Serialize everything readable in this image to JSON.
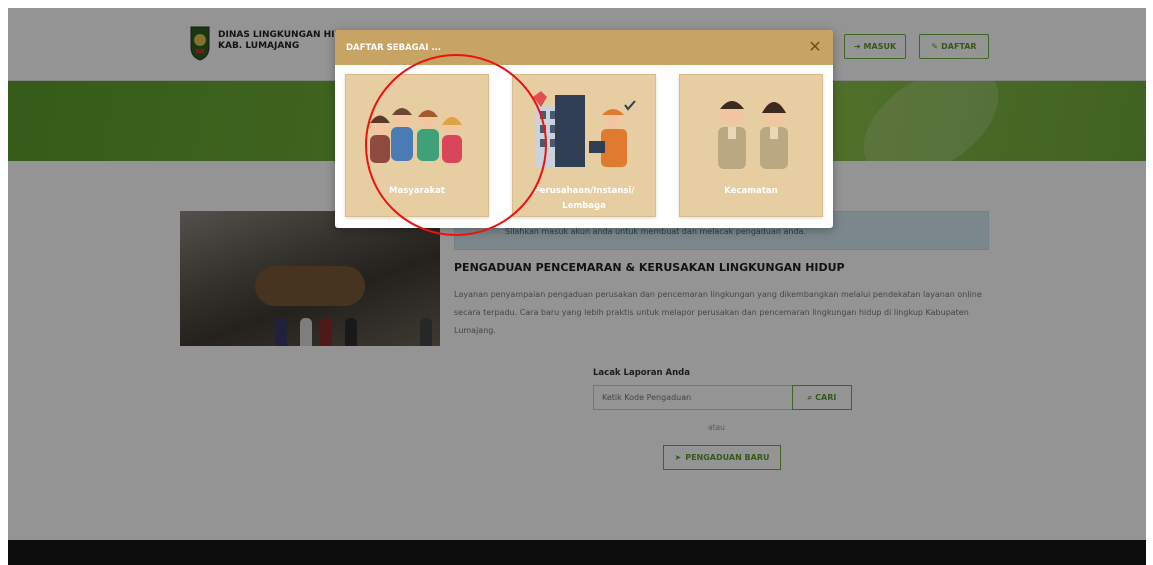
{
  "header": {
    "brand_line1": "DINAS LINGKUNGAN HIDUP",
    "brand_line2": "KAB. LUMAJANG",
    "masuk_label": "MASUK",
    "daftar_label": "DAFTAR"
  },
  "main": {
    "alert_text": "Silahkan masuk akun anda untuk membuat dan melacak pengaduan anda.",
    "section_title": "PENGADUAN PENCEMARAN & KERUSAKAN LINGKUNGAN HIDUP",
    "section_desc": "Layanan penyampaian pengaduan perusakan dan pencemaran lingkungan yang dikembangkan melalui pendekatan layanan online secara terpadu. Cara baru yang lebih praktis untuk melapor perusakan dan pencemaran lingkungan hidup di lingkup Kabupaten Lumajang.",
    "track_label": "Lacak Laporan Anda",
    "track_placeholder": "Ketik Kode Pengaduan",
    "track_button": "CARI",
    "or_text": "atau",
    "new_complaint_button": "PENGADUAN BARU"
  },
  "modal": {
    "title": "DAFTAR SEBAGAI ...",
    "options": [
      {
        "label": "Masyarakat"
      },
      {
        "label": "Perusahaan/Instansi/ Lembaga"
      },
      {
        "label": "Kecamatan"
      }
    ]
  },
  "colors": {
    "modal_header": "#c8a464",
    "card_bg": "#e6cda2",
    "accent_green": "#6cae3a",
    "highlight_circle": "#e11111"
  },
  "icons": [
    "login-icon",
    "edit-icon",
    "search-icon",
    "send-icon",
    "close-icon"
  ]
}
